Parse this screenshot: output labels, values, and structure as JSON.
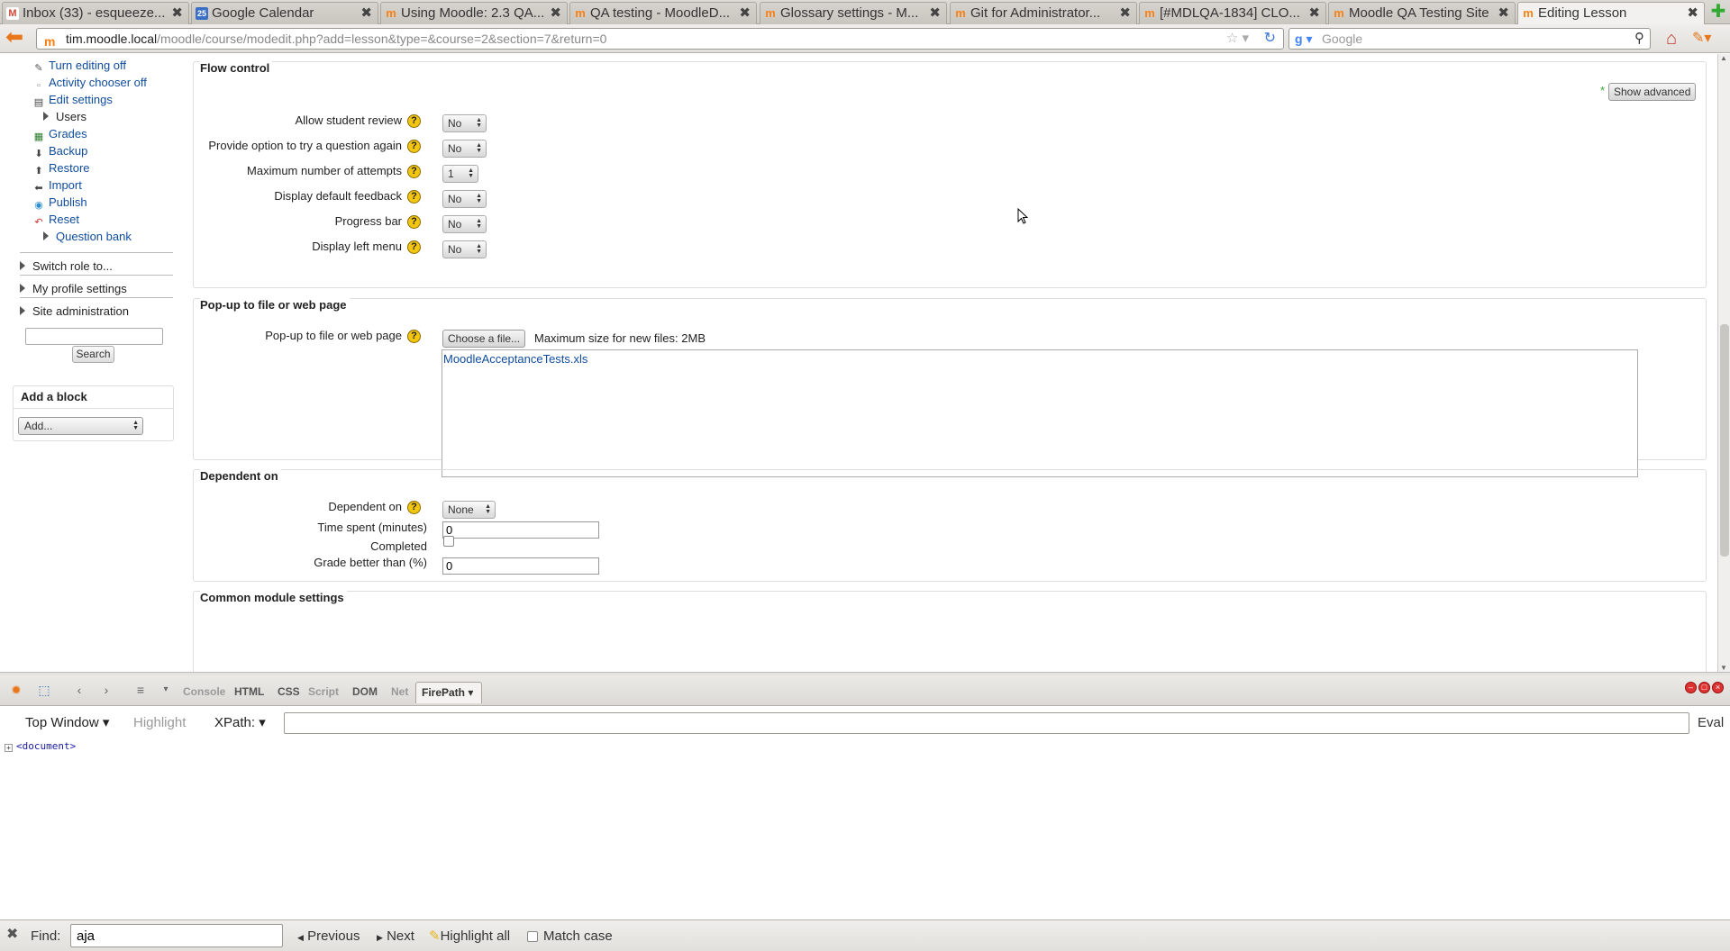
{
  "browser": {
    "tabs": [
      {
        "icon": "gmail-icon",
        "label": "Inbox (33) - esqueeze...",
        "active": false
      },
      {
        "icon": "google-calendar-icon",
        "label": "Google Calendar",
        "active": false
      },
      {
        "icon": "moodle-icon",
        "label": "Using Moodle: 2.3 QA...",
        "active": false
      },
      {
        "icon": "moodle-icon",
        "label": "QA testing - MoodleD...",
        "active": false
      },
      {
        "icon": "moodle-icon",
        "label": "Glossary settings - M...",
        "active": false
      },
      {
        "icon": "moodle-icon",
        "label": "Git for Administrator...",
        "active": false
      },
      {
        "icon": "moodle-icon",
        "label": "[#MDLQA-1834] CLO...",
        "active": false
      },
      {
        "icon": "moodle-icon",
        "label": "Moodle QA Testing Site",
        "active": false
      },
      {
        "icon": "moodle-icon",
        "label": "Editing Lesson",
        "active": true
      }
    ],
    "url_host": "tim.moodle.local",
    "url_path": "/moodle/course/modedit.php?add=lesson&type=&course=2&section=7&return=0",
    "search_placeholder": "Google"
  },
  "sidebar": {
    "admin_items": [
      {
        "label": "Turn editing off",
        "icon": "pencil-icon",
        "link": true,
        "expandable": false
      },
      {
        "label": "Activity chooser off",
        "icon": "dot-icon",
        "link": true,
        "expandable": false
      },
      {
        "label": "Edit settings",
        "icon": "settings-doc-icon",
        "link": true,
        "expandable": false
      },
      {
        "label": "Users",
        "icon": "",
        "link": false,
        "expandable": true
      },
      {
        "label": "Grades",
        "icon": "grades-icon",
        "link": true,
        "expandable": false
      },
      {
        "label": "Backup",
        "icon": "backup-icon",
        "link": true,
        "expandable": false
      },
      {
        "label": "Restore",
        "icon": "restore-icon",
        "link": true,
        "expandable": false
      },
      {
        "label": "Import",
        "icon": "import-icon",
        "link": true,
        "expandable": false
      },
      {
        "label": "Publish",
        "icon": "publish-icon",
        "link": true,
        "expandable": false
      },
      {
        "label": "Reset",
        "icon": "reset-icon",
        "link": true,
        "expandable": false
      },
      {
        "label": "Question bank",
        "icon": "",
        "link": true,
        "expandable": true
      }
    ],
    "sections": [
      "Switch role to...",
      "My profile settings",
      "Site administration"
    ],
    "search_button": "Search",
    "add_block": {
      "title": "Add a block",
      "select_value": "Add..."
    }
  },
  "form": {
    "flow_control": {
      "legend": "Flow control",
      "show_advanced": "Show advanced",
      "advanced_marker": "*",
      "fields": [
        {
          "label": "Allow student review",
          "value": "No"
        },
        {
          "label": "Provide option to try a question again",
          "value": "No"
        },
        {
          "label": "Maximum number of attempts",
          "value": "1"
        },
        {
          "label": "Display default feedback",
          "value": "No"
        },
        {
          "label": "Progress bar",
          "value": "No"
        },
        {
          "label": "Display left menu",
          "value": "No"
        }
      ]
    },
    "popup": {
      "legend": "Pop-up to file or web page",
      "label": "Pop-up to file or web page",
      "choose_button": "Choose a file...",
      "max_size": "Maximum size for new files: 2MB",
      "file_name": "MoodleAcceptanceTests.xls"
    },
    "dependent": {
      "legend": "Dependent on",
      "dependent_on_label": "Dependent on",
      "dependent_on_value": "None",
      "time_label": "Time spent (minutes)",
      "time_value": "0",
      "completed_label": "Completed",
      "grade_label": "Grade better than (%)",
      "grade_value": "0"
    },
    "common": {
      "legend": "Common module settings"
    }
  },
  "firebug": {
    "tabs": [
      "Console",
      "HTML",
      "CSS",
      "Script",
      "DOM",
      "Net"
    ],
    "active_tab": "FirePath",
    "top_window": "Top Window",
    "highlight": "Highlight",
    "xpath_label": "XPath:",
    "xpath_value": "",
    "eval": "Eval",
    "document_node": "<document>"
  },
  "findbar": {
    "label": "Find:",
    "value": "aja",
    "previous": "Previous",
    "next": "Next",
    "highlight_all": "Highlight all",
    "match_case": "Match case"
  }
}
